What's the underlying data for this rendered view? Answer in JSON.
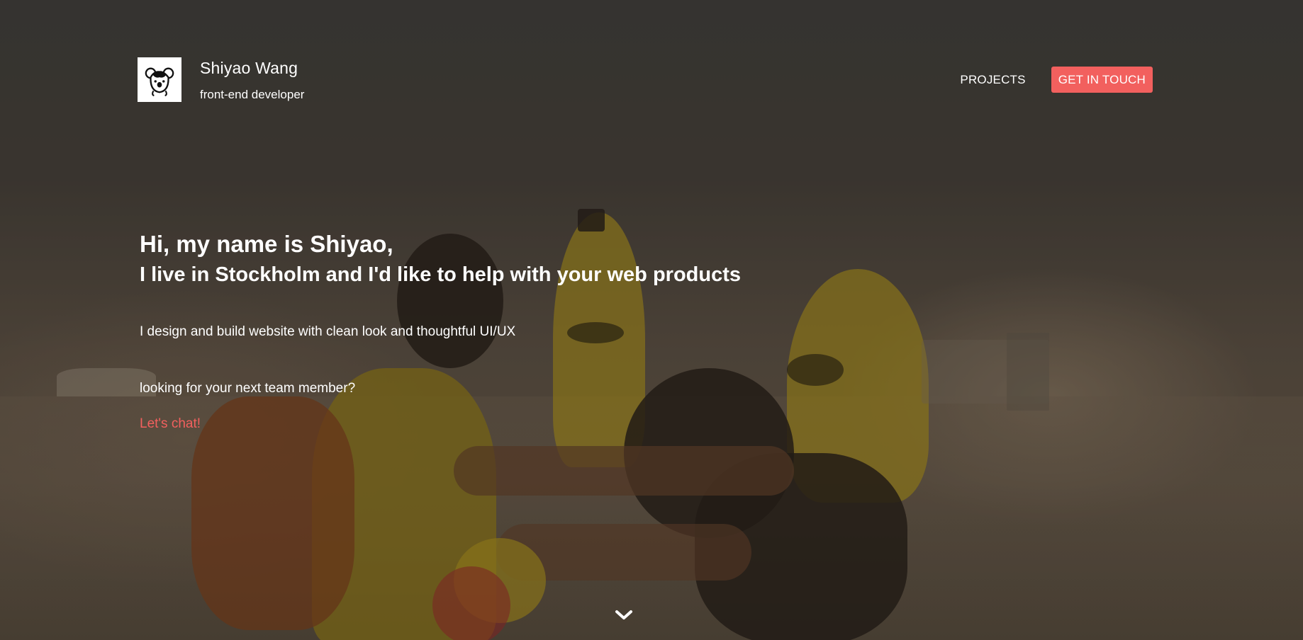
{
  "header": {
    "name": "Shiyao Wang",
    "role": "front-end developer",
    "logo_icon": "koala-icon"
  },
  "nav": {
    "projects_label": "PROJECTS",
    "cta_label": "GET IN TOUCH"
  },
  "intro": {
    "heading_line1": "Hi, my name is Shiyao,",
    "heading_line2": "I live in Stockholm and I'd like to help with your web products",
    "tagline": "I design and build website with clean look and thoughtful UI/UX",
    "question": "looking for your next team member?",
    "chat_link": "Let's chat!"
  },
  "scroll": {
    "icon": "chevron-down-icon"
  },
  "colors": {
    "accent": "#f2605e",
    "text": "#ffffff",
    "logo_bg": "#ffffff"
  }
}
